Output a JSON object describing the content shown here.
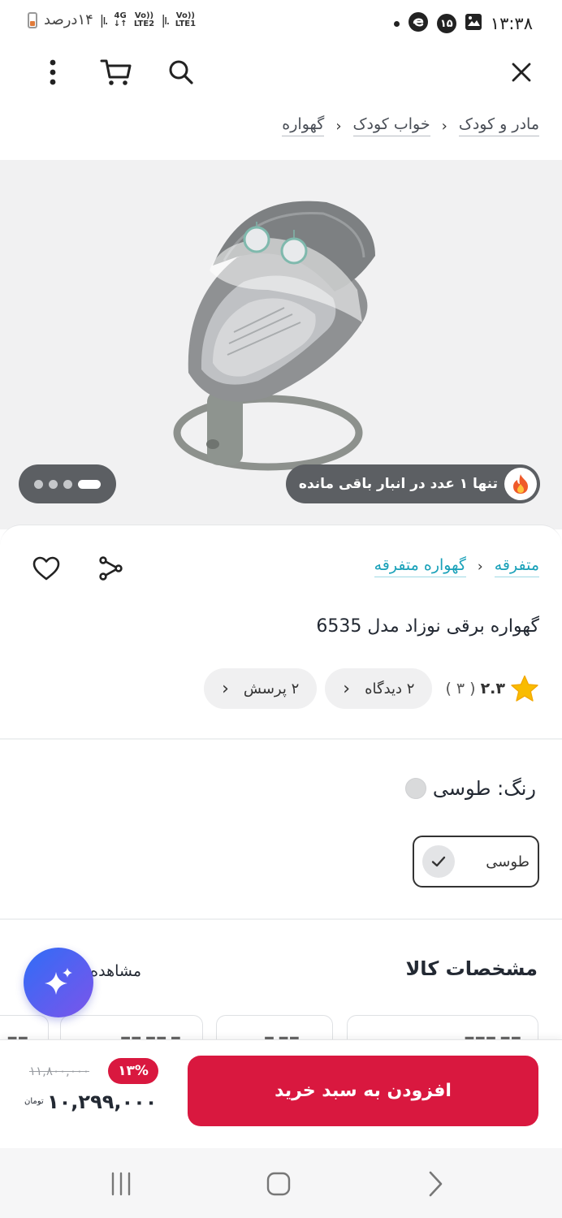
{
  "status_bar": {
    "time": "۱۳:۳۸",
    "notification_count": "۱۵",
    "battery_text": "۱۴درصد",
    "sim1": "Vo)) LTE1",
    "sim2": "Vo)) LTE2",
    "network_type": "4G"
  },
  "toolbar": {
    "close_icon": "close-icon",
    "search_icon": "search-icon",
    "cart_icon": "cart-icon",
    "more_icon": "more-vertical-icon"
  },
  "breadcrumb": [
    "مادر و کودک",
    "خواب کودک",
    "گهواره"
  ],
  "gallery": {
    "stock_message": "تنها ۱ عدد در انبار باقی مانده",
    "background": "#f1f1f2",
    "image_count": 4,
    "active_index": 0
  },
  "product": {
    "categories": [
      "متفرقه",
      "گهواره متفرقه"
    ],
    "title": "گهواره برقی نوزاد مدل 6535",
    "rating": "۲.۳",
    "rating_count": "( ۳ )",
    "reviews_chip": "۲ دیدگاه",
    "questions_chip": "۲ پرسش"
  },
  "color": {
    "label": "رنگ: طوسی",
    "option": "طوسی",
    "swatch": "#d9dadb"
  },
  "specs": {
    "title": "مشخصات کالا",
    "see_all": "مشاهده همه"
  },
  "purchase": {
    "add_to_cart": "افزودن به سبد خرید",
    "old_price": "۱۱,۸۰۰,۰۰۰",
    "discount": "۱۳%",
    "price": "۱۰,۲۹۹,۰۰۰",
    "currency": "تومان",
    "accent": "#d9183f"
  }
}
